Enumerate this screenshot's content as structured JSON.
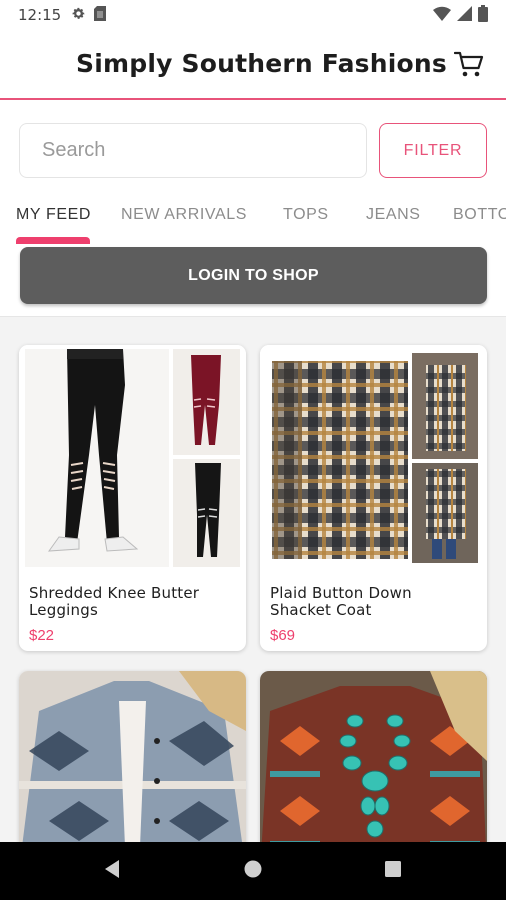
{
  "status_bar": {
    "time": "12:15"
  },
  "header": {
    "title": "Simply Southern Fashions"
  },
  "search": {
    "placeholder": "Search",
    "value": "",
    "filter_label": "FILTER"
  },
  "tabs": [
    {
      "label": "MY FEED",
      "active": true
    },
    {
      "label": "NEW ARRIVALS",
      "active": false
    },
    {
      "label": "TOPS",
      "active": false
    },
    {
      "label": "JEANS",
      "active": false
    },
    {
      "label": "BOTTO",
      "active": false
    }
  ],
  "login": {
    "label": "LOGIN TO SHOP"
  },
  "products": [
    {
      "name": "Shredded Knee Butter Leggings",
      "price": "$22"
    },
    {
      "name": "Plaid Button Down Shacket Coat",
      "price": "$69"
    },
    {
      "name": "",
      "price": ""
    },
    {
      "name": "",
      "price": ""
    }
  ],
  "colors": {
    "accent": "#ee3f6d",
    "login_bg": "#5d5d5d",
    "feed_bg": "#f3f3f3"
  },
  "icons": {
    "status": [
      "settings-icon",
      "sim-card-icon",
      "wifi-icon",
      "signal-icon",
      "battery-icon"
    ],
    "header": "cart-icon",
    "nav": [
      "back-icon",
      "home-icon",
      "recents-icon"
    ]
  }
}
